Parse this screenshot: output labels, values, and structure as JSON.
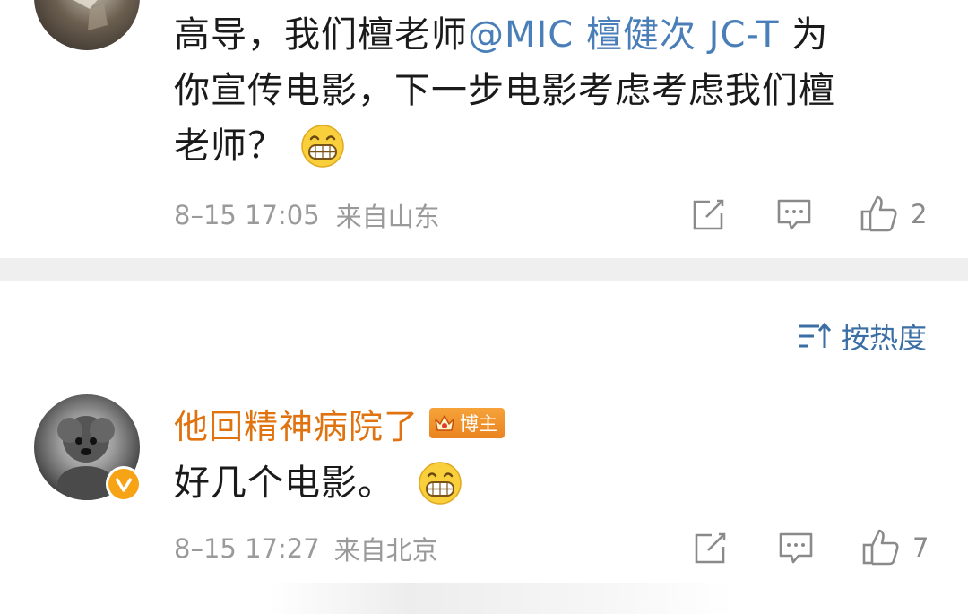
{
  "comment1": {
    "text_line1_before": "高导，我们檀老师",
    "mention": "@MIC 檀健次 JC-T",
    "text_line1_after": "为",
    "text_line2": "你宣传电影，下一步电影考虑考虑我们檀",
    "text_line3": "老师？",
    "emoji": "grinning-face",
    "timestamp": "8–15 17:05",
    "location": "来自山东",
    "like_count": "2"
  },
  "sort": {
    "label": "按热度",
    "icon": "sort-lines-icon"
  },
  "comment2": {
    "username": "他回精神病院了",
    "badge_label": "博主",
    "text": "好几个电影。",
    "emoji": "grinning-face",
    "timestamp": "8–15 17:27",
    "location": "来自北京",
    "like_count": "7"
  },
  "colors": {
    "mention": "#4a7eb8",
    "username": "#e0730f",
    "badge": "#ee8a26",
    "meta": "#9a9a9a",
    "sort": "#3a6ea5",
    "divider": "#efefef"
  }
}
